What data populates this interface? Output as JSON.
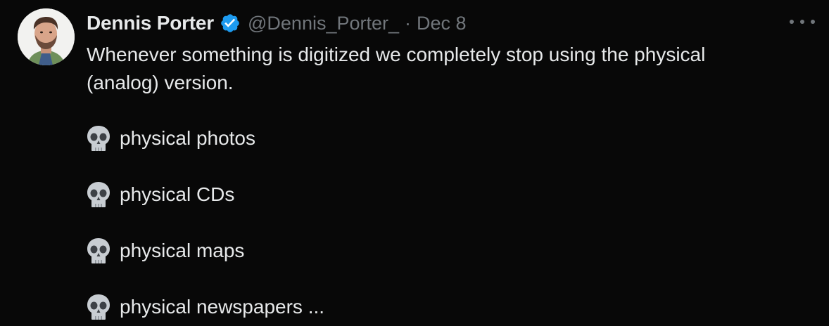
{
  "author": {
    "display_name": "Dennis Porter",
    "handle": "@Dennis_Porter_",
    "separator": "·",
    "date": "Dec 8",
    "verified": true,
    "verified_color": "#1d9bf0"
  },
  "tweet": {
    "text_line1": "Whenever something is digitized we completely stop using the physical",
    "text_line2": "(analog) version.",
    "items": [
      {
        "icon": "skull-icon",
        "label": "physical photos"
      },
      {
        "icon": "skull-icon",
        "label": "physical CDs"
      },
      {
        "icon": "skull-icon",
        "label": "physical maps"
      },
      {
        "icon": "skull-icon",
        "label": "physical newspapers ..."
      }
    ]
  },
  "more_menu": {
    "icon": "more-options-icon"
  }
}
